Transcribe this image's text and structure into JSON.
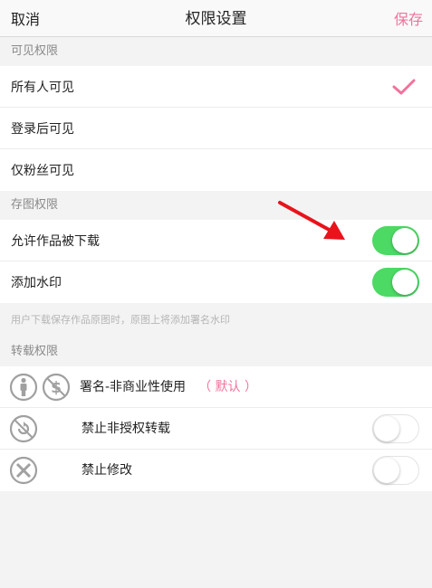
{
  "nav": {
    "cancel": "取消",
    "title": "权限设置",
    "save": "保存"
  },
  "visibility": {
    "header": "可见权限",
    "options": [
      "所有人可见",
      "登录后可见",
      "仅粉丝可见"
    ],
    "selected_index": 0
  },
  "save_image": {
    "header": "存图权限",
    "allow_download": {
      "label": "允许作品被下载",
      "on": true
    },
    "watermark": {
      "label": "添加水印",
      "on": true
    },
    "hint": "用户下载保存作品原图时，原图上将添加署名水印"
  },
  "repost": {
    "header": "转载权限",
    "license": {
      "label": "署名-非商业性使用",
      "default_tag": "（ 默认 ）",
      "icons": [
        "cc-by-icon",
        "cc-nc-icon"
      ]
    },
    "no_unauthorized": {
      "label": "禁止非授权转载",
      "icon": "cc-no-repost-icon",
      "on": false
    },
    "no_modify": {
      "label": "禁止修改",
      "icon": "cc-no-derivatives-icon",
      "on": false
    }
  },
  "colors": {
    "accent": "#f0729e",
    "toggle_on": "#4cd964",
    "arrow": "#e8131b"
  }
}
